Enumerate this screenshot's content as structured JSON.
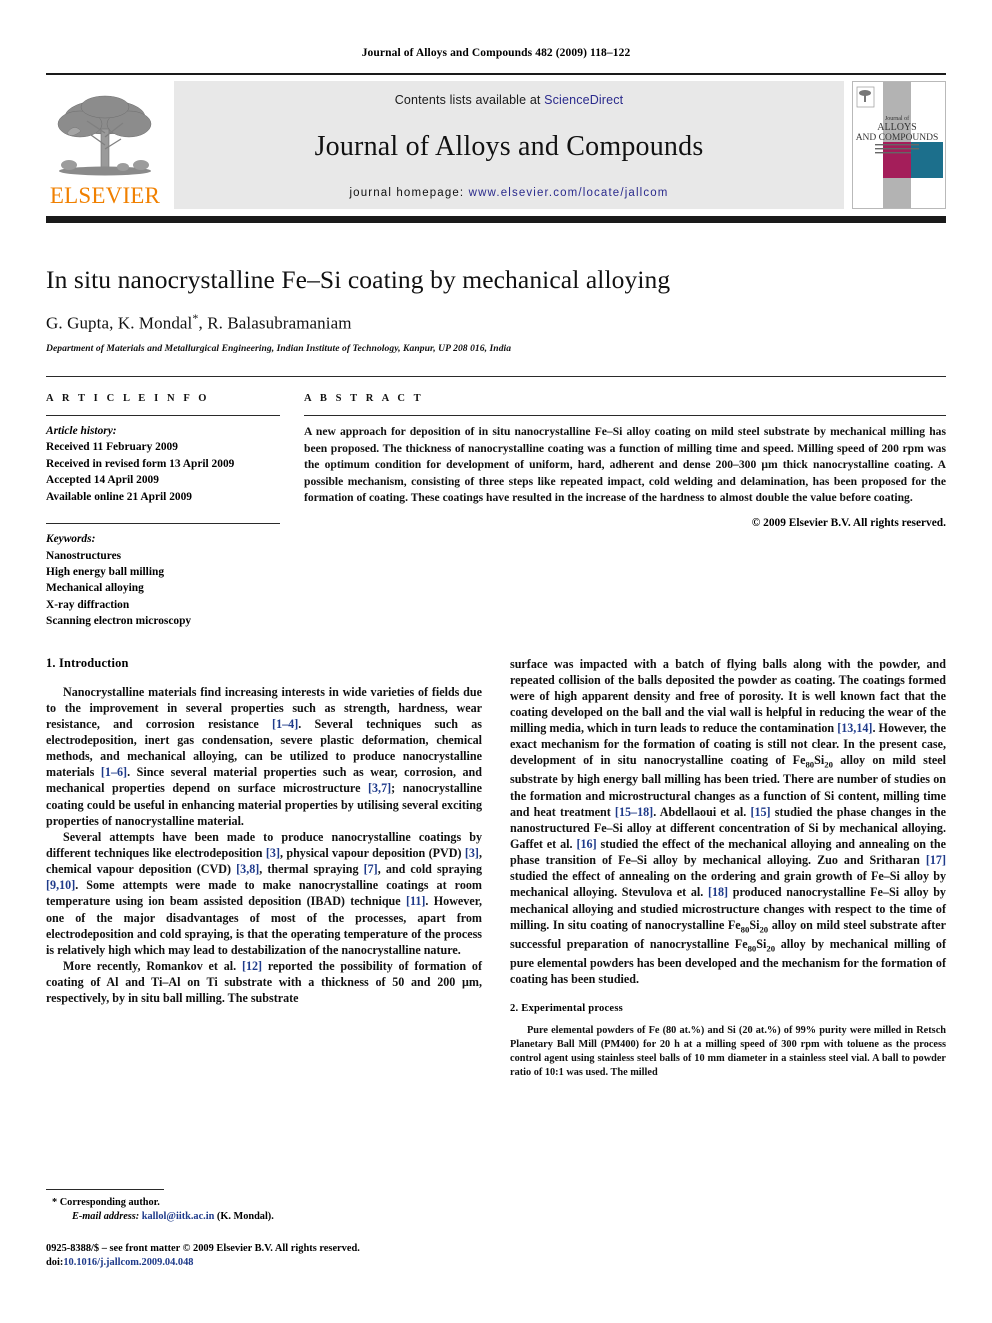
{
  "running_head": "Journal of Alloys and Compounds 482 (2009) 118–122",
  "masthead": {
    "publisher_name": "ELSEVIER",
    "contents_prefix": "Contents lists available at ",
    "sciencedirect": "ScienceDirect",
    "journal_title": "Journal of Alloys and Compounds",
    "homepage_prefix": "journal homepage: ",
    "homepage_url": "www.elsevier.com/locate/jallcom",
    "cover": {
      "line1": "Journal of",
      "line2": "ALLOYS",
      "line3": "AND COMPOUNDS",
      "color_magenta": "#a41e5a",
      "color_teal": "#1c6f8c",
      "color_gray": "#b3b3b3"
    }
  },
  "article": {
    "title": "In situ nanocrystalline Fe–Si coating by mechanical alloying",
    "authors": "G. Gupta, K. Mondal",
    "authors_tail": ", R. Balasubramaniam",
    "corresponding_marker": "*",
    "affiliation": "Department of Materials and Metallurgical Engineering, Indian Institute of Technology, Kanpur, UP 208 016, India"
  },
  "article_info": {
    "heading": "A R T I C L E   I N F O",
    "history_label": "Article history:",
    "history": [
      "Received 11 February 2009",
      "Received in revised form 13 April 2009",
      "Accepted 14 April 2009",
      "Available online 21 April 2009"
    ],
    "keywords_label": "Keywords:",
    "keywords": [
      "Nanostructures",
      "High energy ball milling",
      "Mechanical alloying",
      "X-ray diffraction",
      "Scanning electron microscopy"
    ]
  },
  "abstract": {
    "heading": "A B S T R A C T",
    "text": "A new approach for deposition of in situ nanocrystalline Fe–Si alloy coating on mild steel substrate by mechanical milling has been proposed. The thickness of nanocrystalline coating was a function of milling time and speed. Milling speed of 200 rpm was the optimum condition for development of uniform, hard, adherent and dense 200–300 μm thick nanocrystalline coating. A possible mechanism, consisting of three steps like repeated impact, cold welding and delamination, has been proposed for the formation of coating. These coatings have resulted in the increase of the hardness to almost double the value before coating.",
    "copyright": "© 2009 Elsevier B.V. All rights reserved."
  },
  "sections": {
    "introduction_heading": "1.  Introduction",
    "experimental_heading": "2.  Experimental process"
  },
  "paragraphs": {
    "intro_p1_a": "Nanocrystalline materials find increasing interests in wide varieties of fields due to the improvement in several properties such as strength, hardness, wear resistance, and corrosion resistance ",
    "intro_p1_c1": "[1–4]",
    "intro_p1_b": ". Several techniques such as electrodeposition, inert gas condensation, severe plastic deformation, chemical methods, and mechanical alloying, can be utilized to produce nanocrystalline materials ",
    "intro_p1_c2": "[1–6]",
    "intro_p1_c": ". Since several material properties such as wear, corrosion, and mechanical properties depend on surface microstructure ",
    "intro_p1_c3": "[3,7]",
    "intro_p1_d": "; nanocrystalline coating could be useful in enhancing material properties by utilising several exciting properties of nanocrystalline material.",
    "intro_p2_a": "Several attempts have been made to produce nanocrystalline coatings by different techniques like electrodeposition ",
    "intro_p2_c1": "[3]",
    "intro_p2_b": ", physical vapour deposition (PVD) ",
    "intro_p2_c2": "[3]",
    "intro_p2_c": ", chemical vapour deposition (CVD) ",
    "intro_p2_c3": "[3,8]",
    "intro_p2_d": ", thermal spraying ",
    "intro_p2_c4": "[7]",
    "intro_p2_e": ", and cold spraying ",
    "intro_p2_c5": "[9,10]",
    "intro_p2_f": ". Some attempts were made to make nanocrystalline coatings at room temperature using ion beam assisted deposition (IBAD) technique ",
    "intro_p2_c6": "[11]",
    "intro_p2_g": ". However, one of the major disadvantages of most of the processes, apart from electrodeposition and cold spraying, is that the operating temperature of the process is relatively high which may lead to destabilization of the nanocrystalline nature.",
    "intro_p3_a": "More recently, Romankov et al. ",
    "intro_p3_c1": "[12]",
    "intro_p3_b": " reported the possibility of formation of coating of Al and Ti–Al on Ti substrate with a thickness of 50 and 200 μm, respectively, by in situ ball milling. The substrate",
    "right_p1_a": "surface was impacted with a batch of flying balls along with the powder, and repeated collision of the balls deposited the powder as coating. The coatings formed were of high apparent density and free of porosity. It is well known fact that the coating developed on the ball and the vial wall is helpful in reducing the wear of the milling media, which in turn leads to reduce the contamination ",
    "right_p1_c1": "[13,14]",
    "right_p1_b": ". However, the exact mechanism for the formation of coating is still not clear. In the present case, development of in situ nanocrystalline coating of Fe",
    "right_p1_sub1": "80",
    "right_p1_c": "Si",
    "right_p1_sub2": "20",
    "right_p1_d": " alloy on mild steel substrate by high energy ball milling has been tried. There are number of studies on the formation and microstructural changes as a function of Si content, milling time and heat treatment ",
    "right_p1_c2": "[15–18]",
    "right_p1_e": ". Abdellaoui et al. ",
    "right_p1_c3": "[15]",
    "right_p1_f": " studied the phase changes in the nanostructured Fe–Si alloy at different concentration of Si by mechanical alloying. Gaffet et al. ",
    "right_p1_c4": "[16]",
    "right_p1_g": " studied the effect of the mechanical alloying and annealing on the phase transition of Fe–Si alloy by mechanical alloying. Zuo and Sritharan ",
    "right_p1_c5": "[17]",
    "right_p1_h": " studied the effect of annealing on the ordering and grain growth of Fe–Si alloy by mechanical alloying. Stevulova et al. ",
    "right_p1_c6": "[18]",
    "right_p1_i": " produced nanocrystalline Fe–Si alloy by mechanical alloying and studied microstructure changes with respect to the time of milling. In situ coating of nanocrystalline Fe",
    "right_p1_sub3": "80",
    "right_p1_j": "Si",
    "right_p1_sub4": "20",
    "right_p1_k": " alloy on mild steel substrate after successful preparation of nanocrystalline Fe",
    "right_p1_sub5": "80",
    "right_p1_l": "Si",
    "right_p1_sub6": "20",
    "right_p1_m": " alloy by mechanical milling of pure elemental powders has been developed and the mechanism for the formation of coating has been studied.",
    "exp_p1": "Pure elemental powders of Fe (80 at.%) and Si (20 at.%) of 99% purity were milled in Retsch Planetary Ball Mill (PM400) for 20 h at a milling speed of 300 rpm with toluene as the process control agent using stainless steel balls of 10 mm diameter in a stainless steel vial. A ball to powder ratio of 10:1 was used. The milled"
  },
  "footnotes": {
    "star": "*",
    "corresponding": "Corresponding author.",
    "email_label": "E-mail address:",
    "email": "kallol@iitk.ac.in",
    "email_suffix": " (K. Mondal).",
    "issn_line": "0925-8388/$ – see front matter © 2009 Elsevier B.V. All rights reserved.",
    "doi_label": "doi:",
    "doi_value": "10.1016/j.jallcom.2009.04.048"
  }
}
